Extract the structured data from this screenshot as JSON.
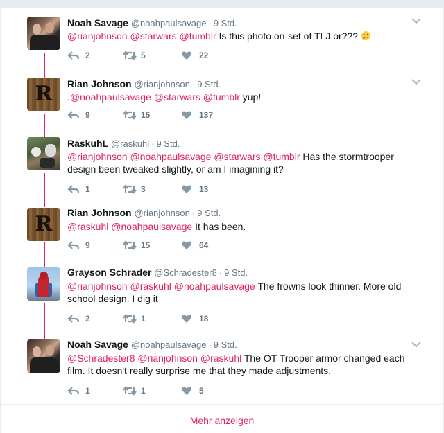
{
  "tweets": [
    {
      "name": "Noah Savage",
      "handle": "@noahpaulsavage",
      "dot": "·",
      "time": "9 Std.",
      "mentions": [
        "@rianjohnson",
        "@starwars",
        "@tumblr"
      ],
      "body": "Is this photo on-set of TLJ or???",
      "emoji": "thinking-face-icon",
      "replies": "2",
      "retweets": "5",
      "likes": "22"
    },
    {
      "name": "Rian Johnson",
      "handle": "@rianjohnson",
      "dot": "·",
      "time": "9 Std.",
      "prefix": ".",
      "mentions": [
        "@noahpaulsavage",
        "@starwars",
        "@tumblr"
      ],
      "body": "yup!",
      "replies": "9",
      "retweets": "15",
      "likes": "137"
    },
    {
      "name": "RaskuhL",
      "handle": "@raskuhl",
      "dot": "·",
      "time": "9 Std.",
      "mentions": [
        "@rianjohnson",
        "@noahpaulsavage",
        "@starwars",
        "@tumblr"
      ],
      "body_line1": "Has the stormtrooper",
      "body_line2": "design been tweaked slightly, or am I imagining it?",
      "replies": "1",
      "retweets": "3",
      "likes": "13"
    },
    {
      "name": "Rian Johnson",
      "handle": "@rianjohnson",
      "dot": "·",
      "time": "9 Std.",
      "mentions": [
        "@raskuhl",
        "@noahpaulsavage"
      ],
      "body": "It has been.",
      "replies": "9",
      "retweets": "15",
      "likes": "64"
    },
    {
      "name": "Grayson Schrader",
      "handle": "@Schradester8",
      "dot": "·",
      "time": "9 Std.",
      "mentions": [
        "@rianjohnson",
        "@raskuhl",
        "@noahpaulsavage"
      ],
      "body_line1": "The frowns look thinner. More old",
      "body_line2": "school design. I dig it",
      "replies": "2",
      "retweets": "1",
      "likes": "18"
    },
    {
      "name": "Noah Savage",
      "handle": "@noahpaulsavage",
      "dot": "·",
      "time": "9 Std.",
      "mentions": [
        "@Schradester8",
        "@rianjohnson",
        "@raskuhl"
      ],
      "body_line1": "The OT Trooper armor changed each",
      "body_line2": "film. It doesn't really surprise me that they made adjustments.",
      "replies": "1",
      "retweets": "1",
      "likes": "5"
    }
  ],
  "avatar_letter": "R",
  "show_more": "Mehr anzeigen",
  "colors": {
    "accent": "#e0245e",
    "muted": "#657786",
    "text": "#14171a",
    "border": "#e6ecf0"
  }
}
